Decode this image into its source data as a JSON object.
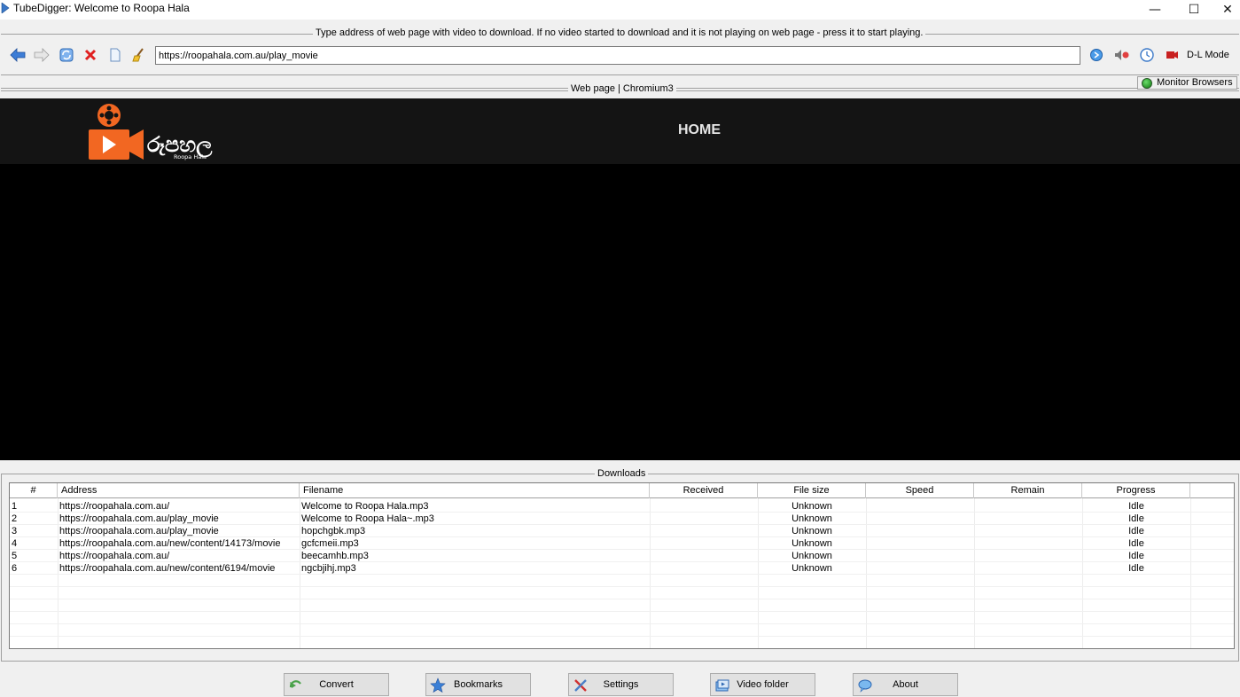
{
  "window": {
    "title": "TubeDigger: Welcome to Roopa Hala",
    "minimize_glyph": "—",
    "maximize_glyph": "☐",
    "close_glyph": "✕"
  },
  "address_bar": {
    "caption": "Type address of web page with video to download. If no video started to download and it is not playing on web page - press it to start playing.",
    "url": "https://roopahala.com.au/play_movie",
    "dl_mode_label": "D-L Mode",
    "icons": [
      "back-icon",
      "forward-icon",
      "refresh-icon",
      "stop-icon",
      "page-icon",
      "clear-icon",
      "go-icon",
      "mute-icon",
      "clock-icon",
      "record-icon"
    ]
  },
  "webview": {
    "caption": "Web page | Chromium3",
    "monitor_label": "Monitor Browsers",
    "site": {
      "logo_text": "රූපහල",
      "logo_subtext": "Roopa Hala",
      "nav_home": "HOME"
    }
  },
  "downloads": {
    "caption": "Downloads",
    "columns": [
      "#",
      "Address",
      "Filename",
      "Received",
      "File size",
      "Speed",
      "Remain",
      "Progress"
    ],
    "rows": [
      {
        "num": "1",
        "address": "https://roopahala.com.au/",
        "filename": "Welcome to Roopa Hala.mp3",
        "received": "",
        "filesize": "Unknown",
        "speed": "",
        "remain": "",
        "progress": "Idle"
      },
      {
        "num": "2",
        "address": "https://roopahala.com.au/play_movie",
        "filename": "Welcome to Roopa Hala~.mp3",
        "received": "",
        "filesize": "Unknown",
        "speed": "",
        "remain": "",
        "progress": "Idle"
      },
      {
        "num": "3",
        "address": "https://roopahala.com.au/play_movie",
        "filename": "hopchgbk.mp3",
        "received": "",
        "filesize": "Unknown",
        "speed": "",
        "remain": "",
        "progress": "Idle"
      },
      {
        "num": "4",
        "address": "https://roopahala.com.au/new/content/14173/movie",
        "filename": "gcfcmeii.mp3",
        "received": "",
        "filesize": "Unknown",
        "speed": "",
        "remain": "",
        "progress": "Idle"
      },
      {
        "num": "5",
        "address": "https://roopahala.com.au/",
        "filename": "beecamhb.mp3",
        "received": "",
        "filesize": "Unknown",
        "speed": "",
        "remain": "",
        "progress": "Idle"
      },
      {
        "num": "6",
        "address": "https://roopahala.com.au/new/content/6194/movie",
        "filename": "ngcbjihj.mp3",
        "received": "",
        "filesize": "Unknown",
        "speed": "",
        "remain": "",
        "progress": "Idle"
      }
    ]
  },
  "bottom_buttons": {
    "convert": "Convert",
    "bookmarks": "Bookmarks",
    "settings": "Settings",
    "video_folder": "Video folder",
    "about": "About"
  },
  "colors": {
    "window_bg": "#f0f0f0",
    "site_header_bg": "#141414",
    "logo_orange": "#f26722"
  }
}
